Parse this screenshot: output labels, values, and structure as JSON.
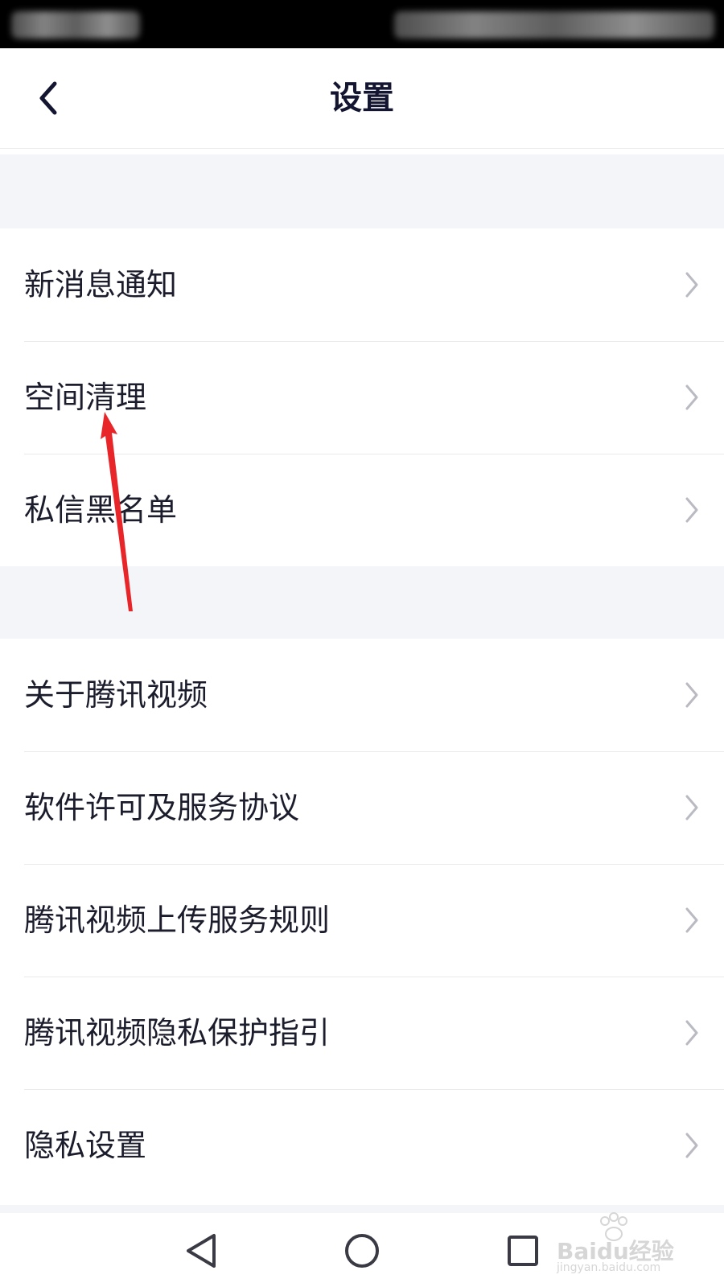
{
  "header": {
    "title": "设置",
    "back_icon": "chevron-left-icon"
  },
  "groups": [
    {
      "items": [
        {
          "label": "新消息通知"
        },
        {
          "label": "空间清理"
        },
        {
          "label": "私信黑名单"
        }
      ]
    },
    {
      "items": [
        {
          "label": "关于腾讯视频"
        },
        {
          "label": "软件许可及服务协议"
        },
        {
          "label": "腾讯视频上传服务规则"
        },
        {
          "label": "腾讯视频隐私保护指引"
        },
        {
          "label": "隐私设置"
        }
      ]
    }
  ],
  "nav": {
    "back_icon": "triangle-back-icon",
    "home_icon": "circle-home-icon",
    "recents_icon": "square-recents-icon"
  },
  "watermark": {
    "logo": "Baidu经验",
    "url": "jingyan.baidu.com"
  },
  "colors": {
    "title": "#141530",
    "text": "#1c1d2c",
    "chevron": "#b9bac2",
    "gap": "#f4f5f9",
    "annotation": "#e8262a"
  }
}
